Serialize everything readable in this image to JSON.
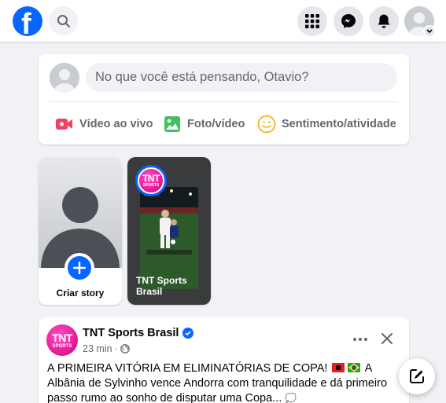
{
  "topbar": {
    "logo_letter": "f",
    "icons": [
      "facebook-logo",
      "search-icon",
      "menu-grid-icon",
      "messenger-icon",
      "bell-icon",
      "avatar",
      "chevron-down-icon"
    ]
  },
  "composer": {
    "placeholder": "No que você está pensando, Otavio?",
    "actions": [
      {
        "label": "Vídeo ao vivo",
        "icon": "live-video-icon",
        "color": "#f3425f"
      },
      {
        "label": "Foto/vídeo",
        "icon": "photo-icon",
        "color": "#45bd62"
      },
      {
        "label": "Sentimento/atividade",
        "icon": "feeling-icon",
        "color": "#f7b928"
      }
    ]
  },
  "stories": {
    "create_label": "Criar story",
    "items": [
      {
        "name": "TNT Sports Brasil",
        "logo_line1": "TNT",
        "logo_line2": "SPORTS"
      }
    ]
  },
  "post": {
    "author": "TNT Sports Brasil",
    "time": "23 min",
    "separator": "·",
    "logo_line1": "TNT",
    "logo_line2": "SPORTS",
    "text_part1": "A PRIMEIRA VITÓRIA EM ELIMINATÓRIAS DE COPA!",
    "text_part2": "A Albânia de Sylvinho vence Andorra com tranquilidade e dá primeiro passo rumo ao sonho de disputar uma Copa...",
    "trailing_emoji": "💭"
  },
  "colors": {
    "brand": "#0866ff",
    "tnt_pink": "#e81c9c",
    "background": "#f0f2f5"
  }
}
